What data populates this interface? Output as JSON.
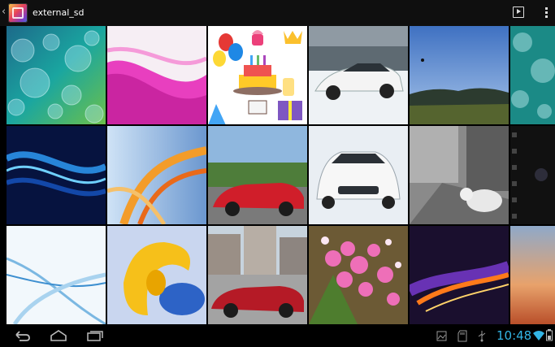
{
  "app_bar": {
    "title": "external_sd",
    "app_icon": "gallery-app-icon",
    "back_icon": "chevron-left-icon",
    "actions": [
      "slideshow-icon",
      "overflow-menu-icon"
    ]
  },
  "grid": {
    "thumbnails": [
      {
        "row": 1,
        "col": 1,
        "subject": "blue-green bokeh abstract"
      },
      {
        "row": 1,
        "col": 2,
        "subject": "pink magenta swirl wallpaper"
      },
      {
        "row": 1,
        "col": 3,
        "subject": "birthday party cartoon with cake, balloons, crown and gifts"
      },
      {
        "row": 1,
        "col": 4,
        "subject": "white sports car in snow"
      },
      {
        "row": 1,
        "col": 5,
        "subject": "landscape with blue sky and hills"
      },
      {
        "row": 1,
        "col": 6,
        "subject": "bokeh abstract (partially visible)"
      },
      {
        "row": 2,
        "col": 1,
        "subject": "blue wave abstract"
      },
      {
        "row": 2,
        "col": 2,
        "subject": "orange and blue curves abstract"
      },
      {
        "row": 2,
        "col": 3,
        "subject": "red convertible car on road"
      },
      {
        "row": 2,
        "col": 4,
        "subject": "white sports car front view"
      },
      {
        "row": 2,
        "col": 5,
        "subject": "black and white street with dog"
      },
      {
        "row": 2,
        "col": 6,
        "subject": "dark film strip (partially visible)"
      },
      {
        "row": 3,
        "col": 1,
        "subject": "light blue lines abstract"
      },
      {
        "row": 3,
        "col": 2,
        "subject": "yellow and blue 3D shapes"
      },
      {
        "row": 3,
        "col": 3,
        "subject": "red convertible in town square"
      },
      {
        "row": 3,
        "col": 4,
        "subject": "pink flowers"
      },
      {
        "row": 3,
        "col": 5,
        "subject": "purple and orange light streaks"
      },
      {
        "row": 3,
        "col": 6,
        "subject": "sunset sky (partially visible)"
      }
    ]
  },
  "nav_bar": {
    "buttons": [
      "back-icon",
      "home-icon",
      "recent-apps-icon"
    ],
    "status_icons": [
      "gallery-notification-icon",
      "sd-card-icon",
      "usb-icon",
      "wifi-icon",
      "battery-icon"
    ],
    "time": "10:48",
    "accent_color": "#33b5e5"
  }
}
